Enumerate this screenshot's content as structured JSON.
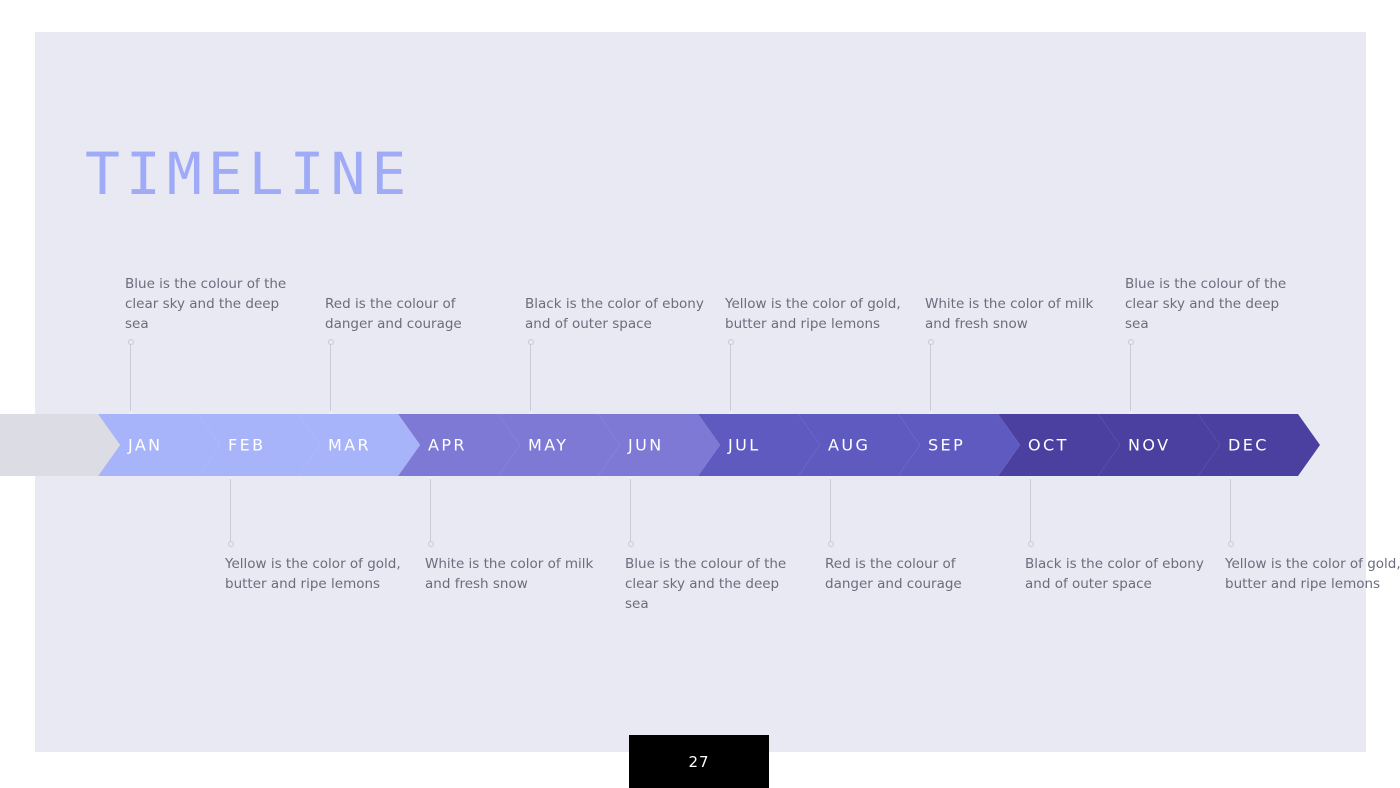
{
  "slide": {
    "title": "TIMELINE",
    "page_number": "27",
    "background_color": "#e9e9f4",
    "title_color": "#9fabf7",
    "text_color": "#6c6c7d",
    "connector_color": "#c9c9d8"
  },
  "timeline": {
    "lead_segment": {
      "label": "",
      "color": "#dcdce4"
    },
    "segments": [
      {
        "label": "JAN",
        "color": "#a7b4f9",
        "note_position": "top",
        "note": "Blue is the colour of the clear sky and the deep sea"
      },
      {
        "label": "FEB",
        "color": "#a7b4f9",
        "note_position": "bottom",
        "note": "Yellow is the color of gold, butter and ripe lemons"
      },
      {
        "label": "MAR",
        "color": "#a7b4f9",
        "note_position": "top",
        "note": "Red is the colour of danger and courage"
      },
      {
        "label": "APR",
        "color": "#7d79d4",
        "note_position": "bottom",
        "note": "White is the color of milk and fresh snow"
      },
      {
        "label": "MAY",
        "color": "#7d79d4",
        "note_position": "top",
        "note": "Black is the color of ebony and of outer space"
      },
      {
        "label": "JUN",
        "color": "#7d79d4",
        "note_position": "bottom",
        "note": "Blue is the colour of the clear sky and the deep sea"
      },
      {
        "label": "JUL",
        "color": "#5f5ac0",
        "note_position": "top",
        "note": "Yellow is the color of gold, butter and ripe lemons"
      },
      {
        "label": "AUG",
        "color": "#5f5ac0",
        "note_position": "bottom",
        "note": "Red is the colour of danger and courage"
      },
      {
        "label": "SEP",
        "color": "#5f5ac0",
        "note_position": "top",
        "note": "White is the color of milk and fresh snow"
      },
      {
        "label": "OCT",
        "color": "#4b40a0",
        "note_position": "bottom",
        "note": "Black is the color of ebony and of outer space"
      },
      {
        "label": "NOV",
        "color": "#4b40a0",
        "note_position": "top",
        "note": "Blue is the colour of the clear sky and the deep sea"
      },
      {
        "label": "DEC",
        "color": "#4b40a0",
        "note_position": "bottom",
        "note": "Yellow is the color of gold, butter and ripe lemons"
      }
    ]
  }
}
